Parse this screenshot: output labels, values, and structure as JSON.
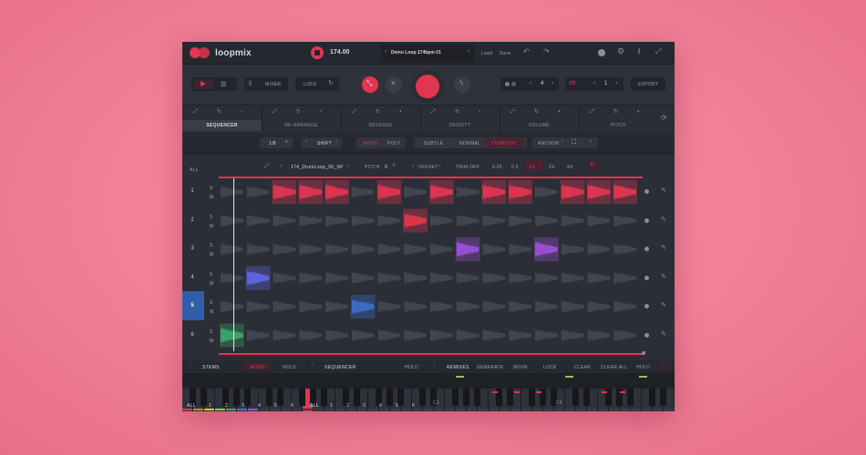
{
  "app": {
    "name": "loopmix"
  },
  "header": {
    "bpm": "174.00",
    "preset": "Demo Loop 174bpm 01",
    "load_label": "Load",
    "save_label": "Save"
  },
  "transport": {
    "mixer_label": "MIXER",
    "lock_label": "LOCK",
    "step_value": "4",
    "loop_value": "1",
    "export_label": "EXPORT"
  },
  "mode_tabs": [
    "SEQUENCER",
    "RE-ARRANGE",
    "REVERSE",
    "DENSITY",
    "VOLUME",
    "PITCH"
  ],
  "options_bar": {
    "division": "1/8",
    "shift_label": "SHIFT",
    "mono_label": "MONO",
    "poly_label": "POLY",
    "subtle_label": "SUBTLE",
    "normal_label": "NORMAL",
    "complex_label": "COMPLEX",
    "anchor_label": "ANCHOR"
  },
  "sample_bar": {
    "all_label": "ALL",
    "sample_name": "174_DrumLoop_06_SP",
    "pitch_label": "PITCH",
    "pitch_value": "0",
    "offset_label": "OFFSET",
    "trim_label": "TRIM OFF",
    "speeds": [
      "0.25",
      "0.5",
      "1X",
      "2X",
      "4X"
    ]
  },
  "lanes": [
    {
      "label": "1",
      "s": "S",
      "m": "M"
    },
    {
      "label": "2",
      "s": "S",
      "m": "M"
    },
    {
      "label": "3",
      "s": "S",
      "m": "M"
    },
    {
      "label": "4",
      "s": "S",
      "m": "M"
    },
    {
      "label": "5",
      "s": "S",
      "m": "M"
    },
    {
      "label": "6",
      "s": "S",
      "m": "M"
    }
  ],
  "bottom": {
    "stems_label": "STEMS",
    "stems_mono": "MONO",
    "stems_hold": "HOLD",
    "sequencer_label": "SEQUENCER",
    "sequencer_hold": "HOLD",
    "remixes_label": "REMIXES",
    "generate_label": "GENERATE",
    "move_label": "MOVE",
    "lock_label": "LOCK",
    "clear_label": "CLEAR",
    "clear_all_label": "CLEAR ALL",
    "hold_label": "HOLD",
    "all_label": "ALL",
    "key_numbers": [
      "1",
      "2",
      "3",
      "4",
      "5",
      "6"
    ],
    "octave_c3": "C3",
    "octave_c4": "C4"
  },
  "colors": {
    "accent": "#e23550",
    "lane3": "#9a4fd8",
    "lane4": "#5f64e0",
    "lane5": "#3a6fc9",
    "lane6": "#3aa56e"
  }
}
